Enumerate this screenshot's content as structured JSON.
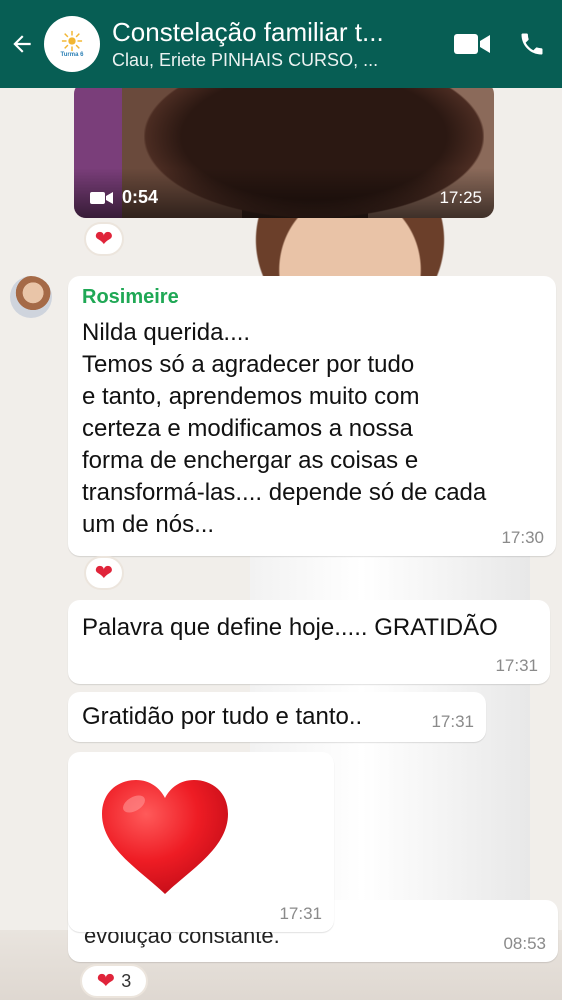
{
  "header": {
    "title": "Constelação familiar t...",
    "subtitle": "Clau, Eriete PINHAIS CURSO, ...",
    "avatar_text": "Turma 6",
    "back_icon": "arrow-left-icon",
    "video_call_icon": "video-camera-icon",
    "call_icon": "phone-icon"
  },
  "messages": {
    "video": {
      "duration": "0:54",
      "time": "17:25",
      "reaction": "❤"
    },
    "rosimeire": {
      "sender": "Rosimeire",
      "text": "Nilda querida....\nTemos só a agradecer por tudo\ne tanto, aprendemos muito com\ncerteza e modificamos a nossa\nforma de enchergar as coisas e\ntransformá-las.... depende só de cada\num de nós...",
      "time": "17:30",
      "reaction": "❤"
    },
    "palavra": {
      "text": "Palavra que define hoje..... GRATIDÃO",
      "time": "17:31"
    },
    "gratidao": {
      "text": "Gratidão por tudo e tanto..",
      "time": "17:31"
    },
    "heart_emoji": {
      "time": "17:31"
    },
    "partial": {
      "text": "evolução constante.",
      "time": "08:53",
      "reaction": "❤",
      "reaction_count": "3"
    }
  },
  "colors": {
    "header_bg": "#075e54",
    "sender_name": "#1fa855",
    "heart": "#e0243a"
  }
}
